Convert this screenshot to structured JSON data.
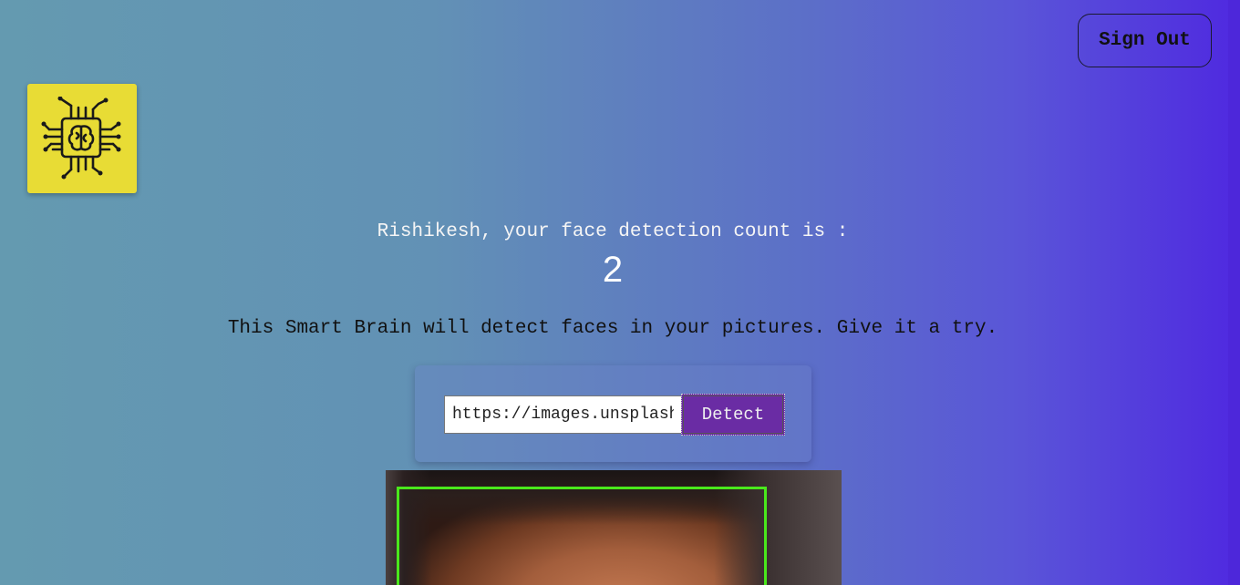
{
  "nav": {
    "sign_out_label": "Sign Out"
  },
  "logo": {
    "icon": "brain-chip-icon",
    "background_color": "#e8dc35"
  },
  "rank": {
    "message": "Rishikesh, your face detection count is :",
    "count": "2"
  },
  "intro": {
    "tagline": "This Smart Brain will detect faces in your pictures. Give it a try."
  },
  "image_form": {
    "url_value": "https://images.unsplash.com/photo",
    "detect_label": "Detect"
  },
  "result": {
    "face_box_color": "#4ae81c"
  },
  "colors": {
    "background_start": "#649ab0",
    "background_end": "#4f29e0",
    "detect_button": "#6a2ca4"
  }
}
